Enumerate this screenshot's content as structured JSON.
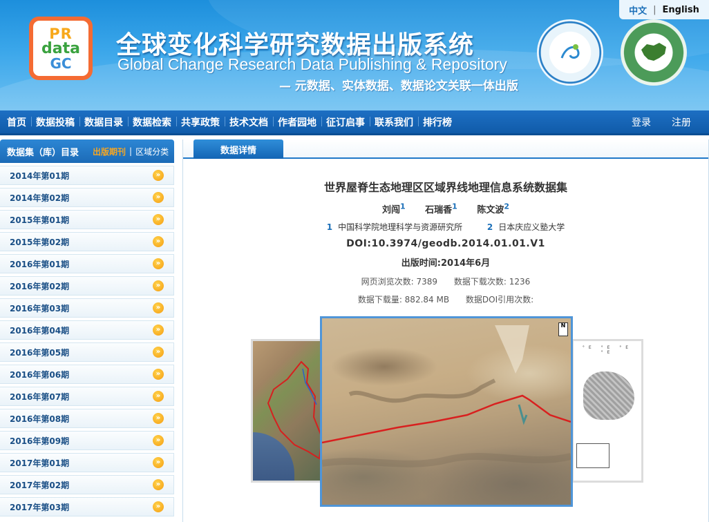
{
  "header": {
    "language": {
      "zh": "中文",
      "sep": "|",
      "en": "English"
    },
    "logo": {
      "line1": "PR",
      "line2": "data",
      "line3": "GC"
    },
    "title_cn": "全球变化科学研究数据出版系统",
    "title_en": "Global Change Research Data Publishing & Repository",
    "slogan": "— 元数据、实体数据、数据论文关联一体出版"
  },
  "nav": {
    "items": [
      "首页",
      "数据投稿",
      "数据目录",
      "数据检索",
      "共享政策",
      "技术文档",
      "作者园地",
      "征订启事",
      "联系我们",
      "排行榜"
    ],
    "login": "登录",
    "register": "注册"
  },
  "sidebar": {
    "title": "数据集（库）目录",
    "tab_active": "出版期刊",
    "tab_sep": "|",
    "tab_other": "区域分类",
    "items": [
      "2014年第01期",
      "2014年第02期",
      "2015年第01期",
      "2015年第02期",
      "2016年第01期",
      "2016年第02期",
      "2016年第03期",
      "2016年第04期",
      "2016年第05期",
      "2016年第06期",
      "2016年第07期",
      "2016年第08期",
      "2016年第09期",
      "2017年第01期",
      "2017年第02期",
      "2017年第03期"
    ]
  },
  "main": {
    "tab": "数据详情",
    "title": "世界屋脊生态地理区区域界线地理信息系统数据集",
    "authors": [
      {
        "name": "刘闯",
        "sup": "1"
      },
      {
        "name": "石瑞香",
        "sup": "1"
      },
      {
        "name": "陈文波",
        "sup": "2"
      }
    ],
    "affiliations": [
      {
        "num": "1",
        "name": "中国科学院地理科学与资源研究所"
      },
      {
        "num": "2",
        "name": "日本庆应义塾大学"
      }
    ],
    "doi": "DOI:10.3974/geodb.2014.01.01.V1",
    "pub_date": "出版时间:2014年6月",
    "views": "网页浏览次数: 7389",
    "downloads": "数据下载次数: 1236",
    "download_size": "数据下载量: 882.84 MB",
    "doi_citations": "数据DOI引用次数:"
  },
  "colors": {
    "header_blue": "#1d8fdc",
    "nav_blue": "#105ba9",
    "accent_orange": "#f6a623",
    "link_blue": "#1b6fb8"
  }
}
